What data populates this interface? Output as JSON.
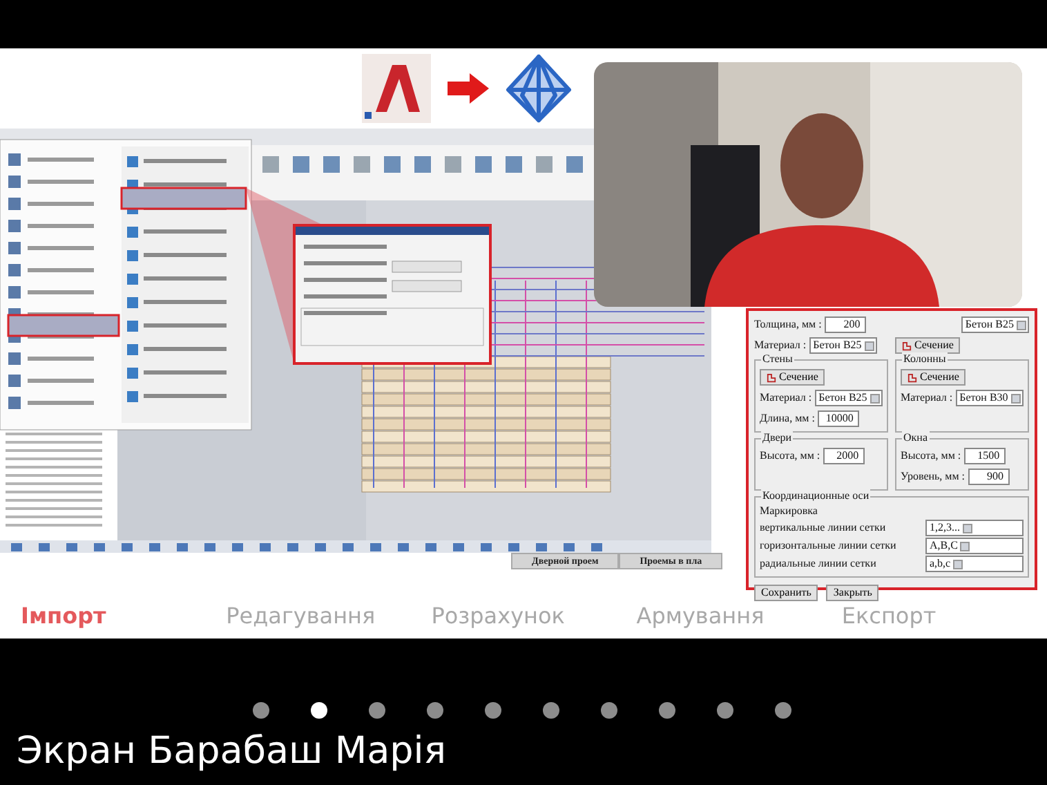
{
  "slide": {
    "screenshot_tabs": [
      "Дверной проем",
      "Проемы в пла"
    ],
    "form": {
      "top_left": [
        {
          "kind": "input",
          "label": "Толщина, мм :",
          "value": "200"
        },
        {
          "kind": "select",
          "label": "Материал :",
          "value": "Бетон В25"
        }
      ],
      "top_right": {
        "select": "Бетон В25",
        "button": "Сечение"
      },
      "groups": [
        {
          "title": "Стены",
          "button": "Сечение",
          "fields": [
            {
              "kind": "select",
              "label": "Материал :",
              "value": "Бетон В25"
            },
            {
              "kind": "input",
              "label": "Длина, мм :",
              "value": "10000"
            }
          ]
        },
        {
          "title": "Колонны",
          "button": "Сечение",
          "fields": [
            {
              "kind": "select",
              "label": "Материал :",
              "value": "Бетон В30"
            }
          ]
        },
        {
          "title": "Двери",
          "fields": [
            {
              "kind": "input",
              "label": "Высота, мм :",
              "value": "2000"
            }
          ]
        },
        {
          "title": "Окна",
          "fields": [
            {
              "kind": "input",
              "label": "Высота, мм :",
              "value": "1500"
            },
            {
              "kind": "input",
              "label": "Уровень, мм :",
              "value": "900"
            }
          ]
        }
      ],
      "axes": {
        "title": "Координационные оси",
        "subtitle": "Маркировка",
        "rows": [
          {
            "label": "вертикальные линии сетки",
            "value": "1,2,3..."
          },
          {
            "label": "горизонтальные линии сетки",
            "value": "A,B,C"
          },
          {
            "label": "радиальные линии сетки",
            "value": "a,b,c"
          }
        ]
      },
      "buttons": [
        "Сохранить",
        "Закрыть"
      ]
    },
    "steps": [
      {
        "label": "Імпорт",
        "selected": true
      },
      {
        "label": "Редагування",
        "selected": false
      },
      {
        "label": "Розрахунок",
        "selected": false
      },
      {
        "label": "Армування",
        "selected": false
      },
      {
        "label": "Експорт",
        "selected": false
      }
    ]
  },
  "pagination": [
    {
      "selected": false
    },
    {
      "selected": true
    },
    {
      "selected": false
    },
    {
      "selected": false
    },
    {
      "selected": false
    },
    {
      "selected": false
    },
    {
      "selected": false
    },
    {
      "selected": false
    },
    {
      "selected": false
    },
    {
      "selected": false
    }
  ],
  "caption": "Экран Барабаш Марія"
}
